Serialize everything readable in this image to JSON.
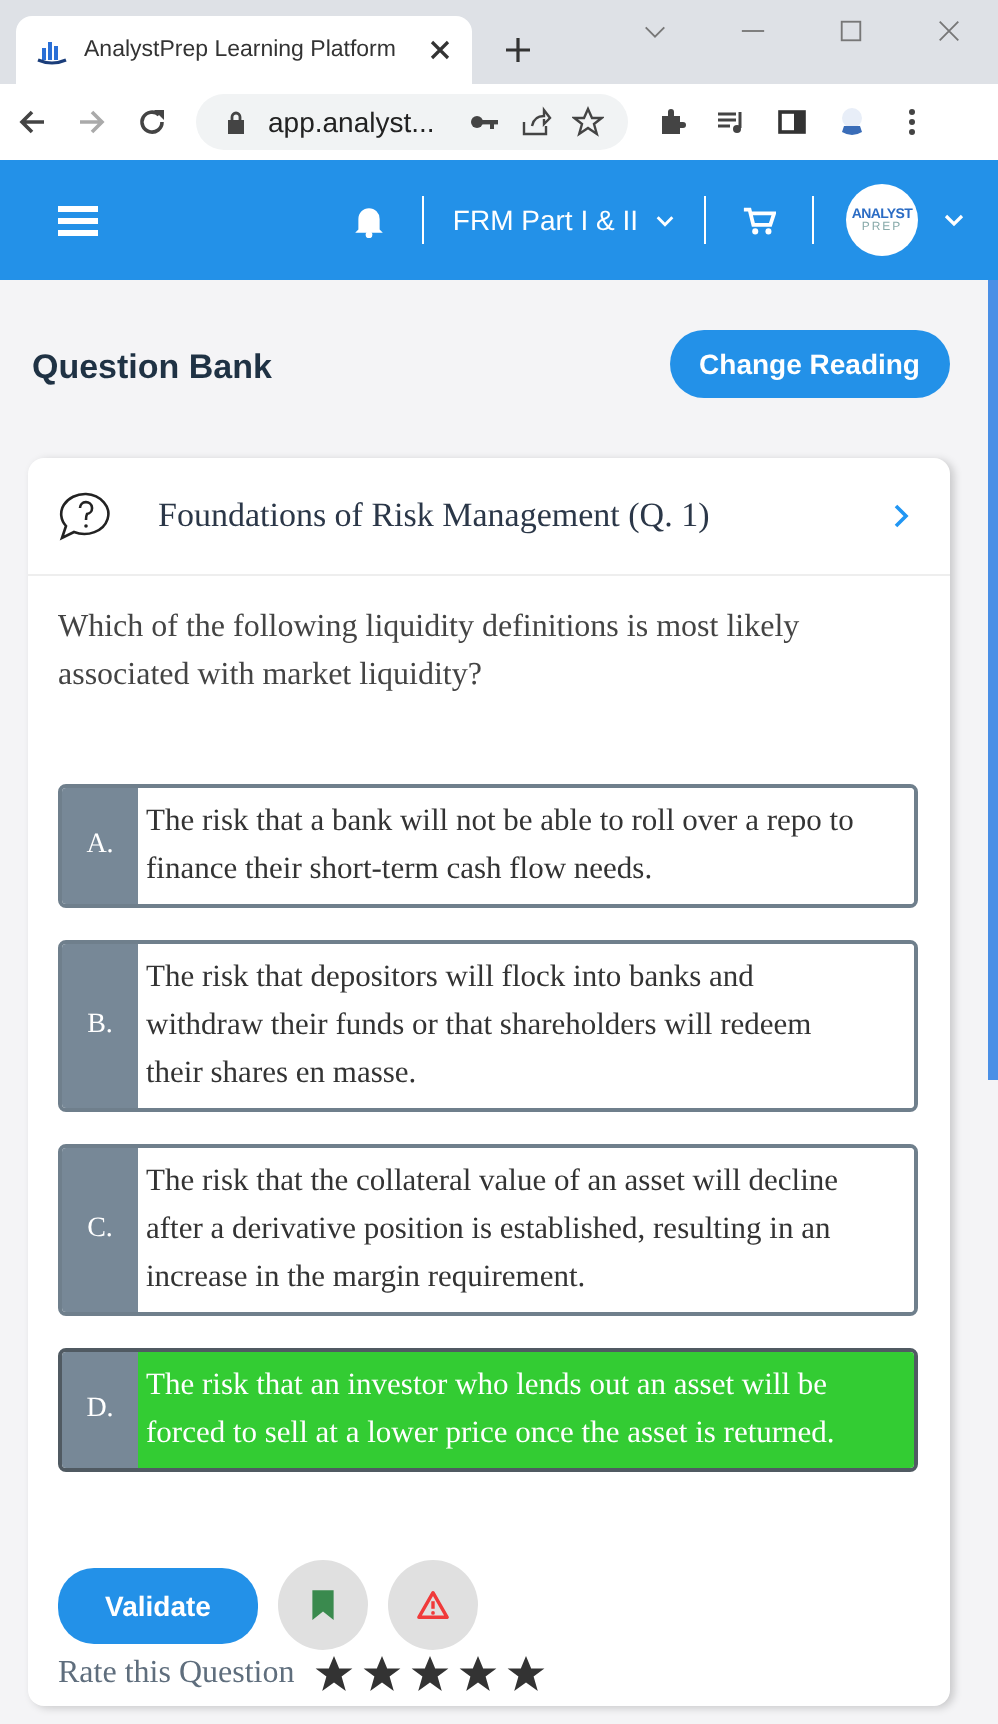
{
  "browser": {
    "tab_title": "AnalystPrep Learning Platform",
    "url": "app.analyst..."
  },
  "app_bar": {
    "program": "FRM Part I & II",
    "avatar_lines": [
      "ANALYST",
      "PREP"
    ]
  },
  "page": {
    "title": "Question Bank",
    "change_button": "Change Reading"
  },
  "question": {
    "title": "Foundations of Risk Management (Q. 1)",
    "text": "Which of the following liquidity definitions is most likely associated with market liquidity?",
    "options": [
      {
        "letter": "A.",
        "text": "The risk that a bank will not be able to roll over a repo to finance their short-term cash flow needs.",
        "selected": false
      },
      {
        "letter": "B.",
        "text": "The risk that depositors will flock into banks and withdraw their funds or that shareholders will redeem their shares en masse.",
        "selected": false
      },
      {
        "letter": "C.",
        "text": "The risk that the collateral value of an asset will decline after a derivative position is established, resulting in an increase in the margin requirement.",
        "selected": false
      },
      {
        "letter": "D.",
        "text": "The risk that an investor who lends out an asset will be forced to sell at a lower price once the asset is returned.",
        "selected": true
      }
    ],
    "validate_button": "Validate",
    "rating": {
      "label": "Rate this Question",
      "stars": 5
    }
  }
}
